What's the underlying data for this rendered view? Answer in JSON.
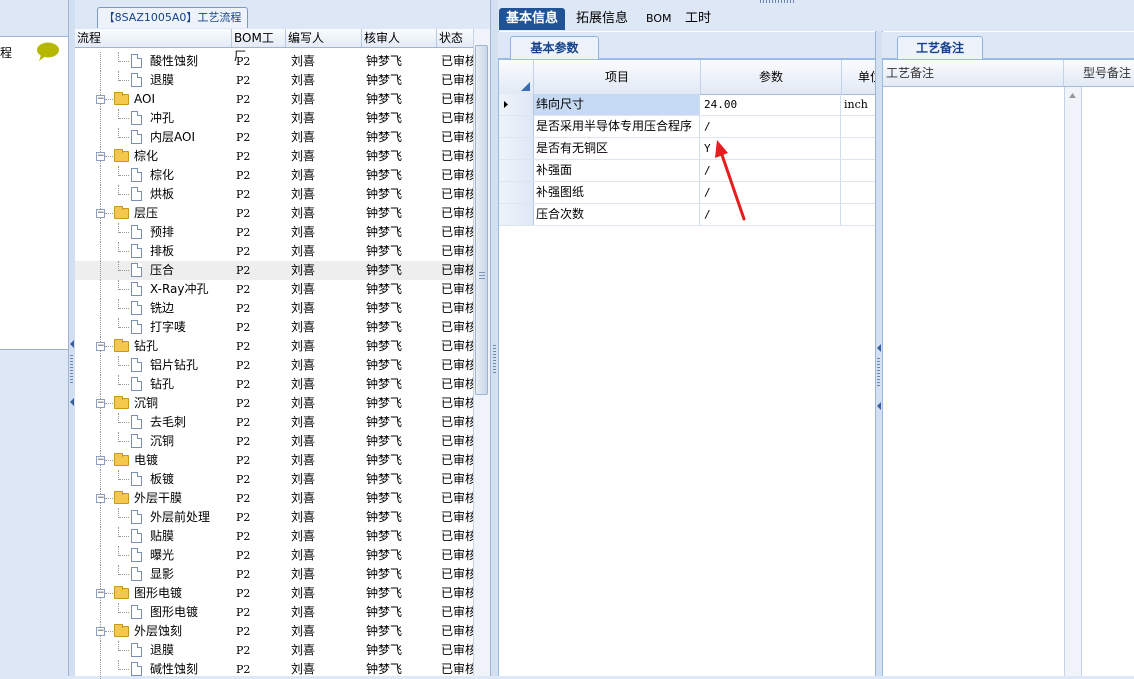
{
  "left_panel": {
    "title": "程"
  },
  "tree": {
    "tab_title": "【8SAZ1005A0】工艺流程",
    "columns": [
      "流程",
      "BOM工厂",
      "编写人",
      "核审人",
      "状态"
    ],
    "rows": [
      {
        "level": 2,
        "name": "酸性蚀刻",
        "bom": "P2",
        "author": "刘喜",
        "reviewer": "钟梦飞",
        "status": "已审核"
      },
      {
        "level": 2,
        "name": "退膜",
        "bom": "P2",
        "author": "刘喜",
        "reviewer": "钟梦飞",
        "status": "已审核"
      },
      {
        "level": 1,
        "name": "AOI",
        "bom": "P2",
        "author": "刘喜",
        "reviewer": "钟梦飞",
        "status": "已审核"
      },
      {
        "level": 2,
        "name": "冲孔",
        "bom": "P2",
        "author": "刘喜",
        "reviewer": "钟梦飞",
        "status": "已审核"
      },
      {
        "level": 2,
        "name": "内层AOI",
        "bom": "P2",
        "author": "刘喜",
        "reviewer": "钟梦飞",
        "status": "已审核"
      },
      {
        "level": 1,
        "name": "棕化",
        "bom": "P2",
        "author": "刘喜",
        "reviewer": "钟梦飞",
        "status": "已审核"
      },
      {
        "level": 2,
        "name": "棕化",
        "bom": "P2",
        "author": "刘喜",
        "reviewer": "钟梦飞",
        "status": "已审核"
      },
      {
        "level": 2,
        "name": "烘板",
        "bom": "P2",
        "author": "刘喜",
        "reviewer": "钟梦飞",
        "status": "已审核"
      },
      {
        "level": 1,
        "name": "层压",
        "bom": "P2",
        "author": "刘喜",
        "reviewer": "钟梦飞",
        "status": "已审核"
      },
      {
        "level": 2,
        "name": "预排",
        "bom": "P2",
        "author": "刘喜",
        "reviewer": "钟梦飞",
        "status": "已审核"
      },
      {
        "level": 2,
        "name": "排板",
        "bom": "P2",
        "author": "刘喜",
        "reviewer": "钟梦飞",
        "status": "已审核"
      },
      {
        "level": 2,
        "name": "压合",
        "bom": "P2",
        "author": "刘喜",
        "reviewer": "钟梦飞",
        "status": "已审核",
        "selected": true
      },
      {
        "level": 2,
        "name": "X-Ray冲孔",
        "bom": "P2",
        "author": "刘喜",
        "reviewer": "钟梦飞",
        "status": "已审核"
      },
      {
        "level": 2,
        "name": "铣边",
        "bom": "P2",
        "author": "刘喜",
        "reviewer": "钟梦飞",
        "status": "已审核"
      },
      {
        "level": 2,
        "name": "打字唛",
        "bom": "P2",
        "author": "刘喜",
        "reviewer": "钟梦飞",
        "status": "已审核"
      },
      {
        "level": 1,
        "name": "钻孔",
        "bom": "P2",
        "author": "刘喜",
        "reviewer": "钟梦飞",
        "status": "已审核"
      },
      {
        "level": 2,
        "name": "铝片钻孔",
        "bom": "P2",
        "author": "刘喜",
        "reviewer": "钟梦飞",
        "status": "已审核"
      },
      {
        "level": 2,
        "name": "钻孔",
        "bom": "P2",
        "author": "刘喜",
        "reviewer": "钟梦飞",
        "status": "已审核"
      },
      {
        "level": 1,
        "name": "沉铜",
        "bom": "P2",
        "author": "刘喜",
        "reviewer": "钟梦飞",
        "status": "已审核"
      },
      {
        "level": 2,
        "name": "去毛刺",
        "bom": "P2",
        "author": "刘喜",
        "reviewer": "钟梦飞",
        "status": "已审核"
      },
      {
        "level": 2,
        "name": "沉铜",
        "bom": "P2",
        "author": "刘喜",
        "reviewer": "钟梦飞",
        "status": "已审核"
      },
      {
        "level": 1,
        "name": "电镀",
        "bom": "P2",
        "author": "刘喜",
        "reviewer": "钟梦飞",
        "status": "已审核"
      },
      {
        "level": 2,
        "name": "板镀",
        "bom": "P2",
        "author": "刘喜",
        "reviewer": "钟梦飞",
        "status": "已审核"
      },
      {
        "level": 1,
        "name": "外层干膜",
        "bom": "P2",
        "author": "刘喜",
        "reviewer": "钟梦飞",
        "status": "已审核"
      },
      {
        "level": 2,
        "name": "外层前处理",
        "bom": "P2",
        "author": "刘喜",
        "reviewer": "钟梦飞",
        "status": "已审核"
      },
      {
        "level": 2,
        "name": "贴膜",
        "bom": "P2",
        "author": "刘喜",
        "reviewer": "钟梦飞",
        "status": "已审核"
      },
      {
        "level": 2,
        "name": "曝光",
        "bom": "P2",
        "author": "刘喜",
        "reviewer": "钟梦飞",
        "status": "已审核"
      },
      {
        "level": 2,
        "name": "显影",
        "bom": "P2",
        "author": "刘喜",
        "reviewer": "钟梦飞",
        "status": "已审核"
      },
      {
        "level": 1,
        "name": "图形电镀",
        "bom": "P2",
        "author": "刘喜",
        "reviewer": "钟梦飞",
        "status": "已审核"
      },
      {
        "level": 2,
        "name": "图形电镀",
        "bom": "P2",
        "author": "刘喜",
        "reviewer": "钟梦飞",
        "status": "已审核"
      },
      {
        "level": 1,
        "name": "外层蚀刻",
        "bom": "P2",
        "author": "刘喜",
        "reviewer": "钟梦飞",
        "status": "已审核"
      },
      {
        "level": 2,
        "name": "退膜",
        "bom": "P2",
        "author": "刘喜",
        "reviewer": "钟梦飞",
        "status": "已审核"
      },
      {
        "level": 2,
        "name": "碱性蚀刻",
        "bom": "P2",
        "author": "刘喜",
        "reviewer": "钟梦飞",
        "status": "已审核"
      }
    ]
  },
  "main_tabs": [
    "基本信息",
    "拓展信息",
    "BOM",
    "工时"
  ],
  "params_panel": {
    "subtab": "基本参数",
    "columns": [
      "项目",
      "参数",
      "单位"
    ],
    "rows": [
      {
        "item": "纬向尺寸",
        "value": "24.00",
        "unit": "inch",
        "current": true
      },
      {
        "item": "是否采用半导体专用压合程序",
        "value": "/",
        "unit": ""
      },
      {
        "item": "是否有无铜区",
        "value": "Y",
        "unit": ""
      },
      {
        "item": "补强面",
        "value": "/",
        "unit": ""
      },
      {
        "item": "补强图纸",
        "value": "/",
        "unit": ""
      },
      {
        "item": "压合次数",
        "value": "/",
        "unit": ""
      }
    ]
  },
  "notes_panel": {
    "subtab": "工艺备注",
    "columns": [
      "工艺备注",
      "型号备注"
    ]
  },
  "colors": {
    "accent": "#1f5396",
    "annotation_arrow": "#e41e1e",
    "bubble": "#b5b800"
  }
}
